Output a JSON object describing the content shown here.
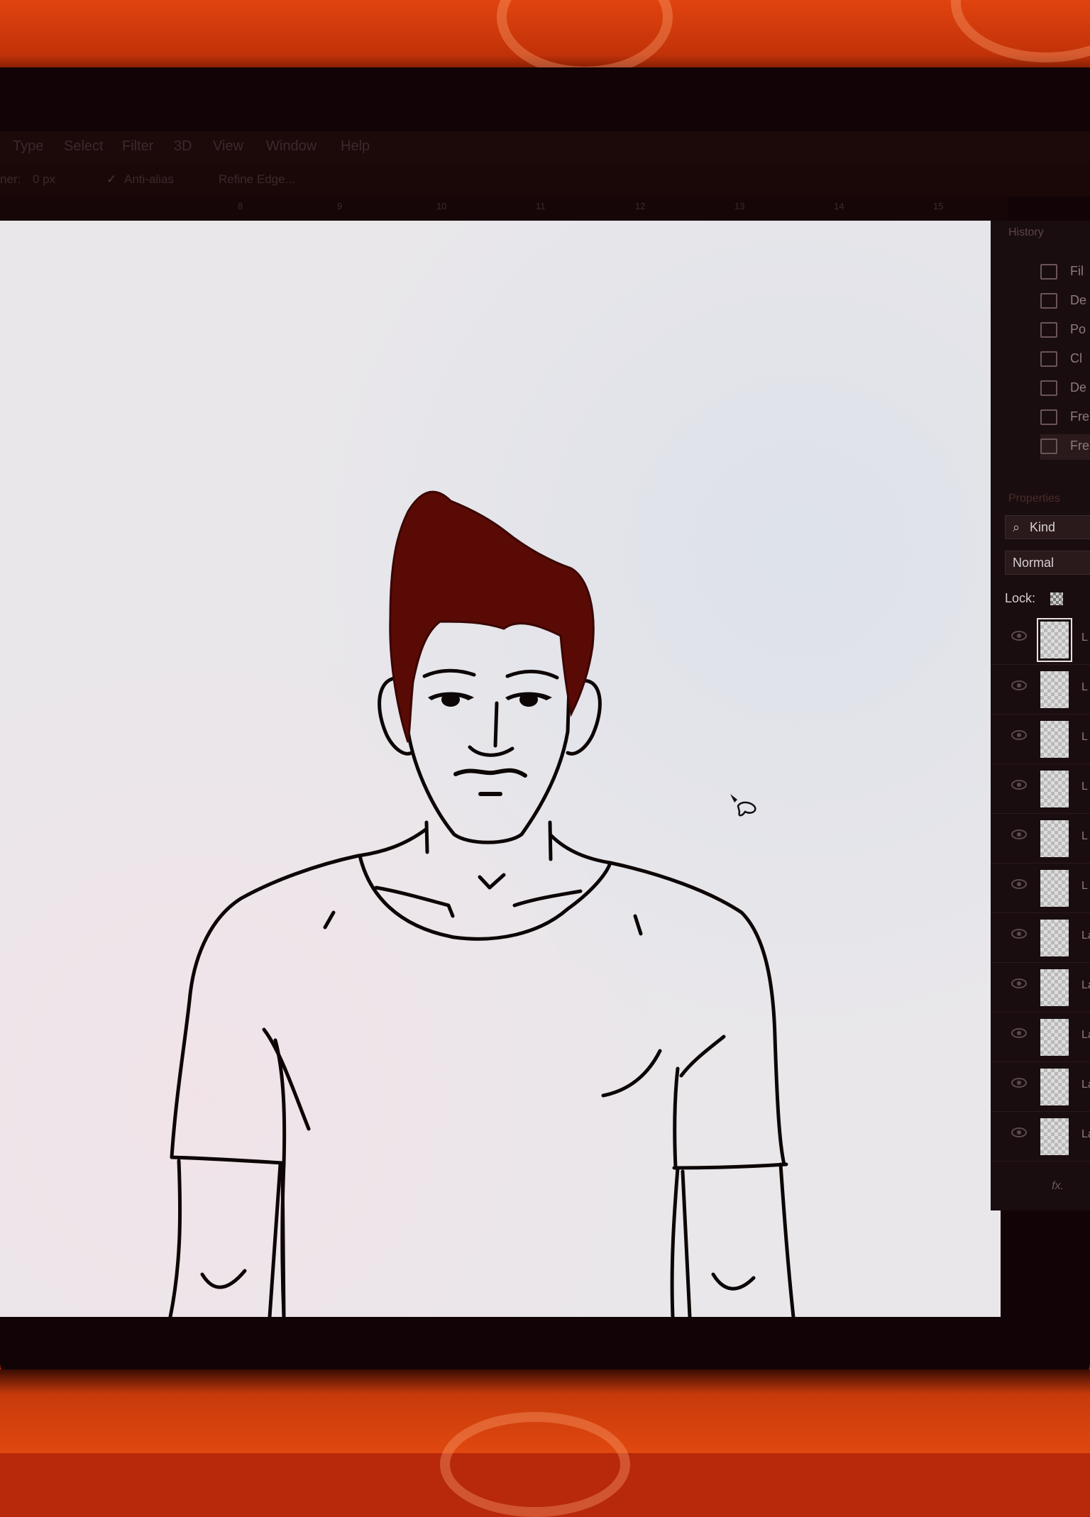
{
  "app": {
    "menu": [
      "Type",
      "Select",
      "Filter",
      "3D",
      "View",
      "Window",
      "Help"
    ],
    "options_bar": {
      "feather_label": "ner:",
      "feather_value": "0 px",
      "anti_alias_label": "Anti-alias",
      "refine_edge": "Refine Edge..."
    },
    "ruler_ticks": [
      "8",
      "9",
      "10",
      "11",
      "12",
      "13",
      "14",
      "15"
    ]
  },
  "history_panel": {
    "title": "History",
    "items": [
      "Fil",
      "De",
      "Po",
      "Cl",
      "De",
      "Fre",
      "Fre"
    ]
  },
  "layers_panel": {
    "tab": "Properties",
    "kind_label": "Kind",
    "blend_mode": "Normal",
    "lock_label": "Lock:",
    "layers": [
      "L",
      "L",
      "L",
      "L",
      "L",
      "L",
      "La",
      "La",
      "La",
      "La",
      "La"
    ],
    "footer": [
      "fx."
    ]
  },
  "colors": {
    "hair": "#5a0a05",
    "canvas": "#e9e7ea",
    "line": "#0d0606",
    "panel_bg": "#1a0d0f"
  }
}
